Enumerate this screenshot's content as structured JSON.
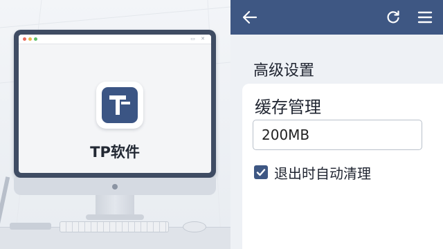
{
  "illustration": {
    "app_name": "TP软件",
    "browser_controls": "▭ ✕"
  },
  "toolbar": {
    "back_icon": "arrow-left-icon",
    "refresh_icon": "refresh-icon",
    "menu_icon": "hamburger-menu-icon"
  },
  "settings": {
    "section_title": "高级设置",
    "cache": {
      "title": "缓存管理",
      "value": "200MB"
    },
    "auto_clean": {
      "label": "退出时自动清理",
      "checked": true
    }
  },
  "colors": {
    "accent": "#3e5783",
    "app_icon": "#3b5584",
    "monitor_frame": "#3f4c63"
  }
}
